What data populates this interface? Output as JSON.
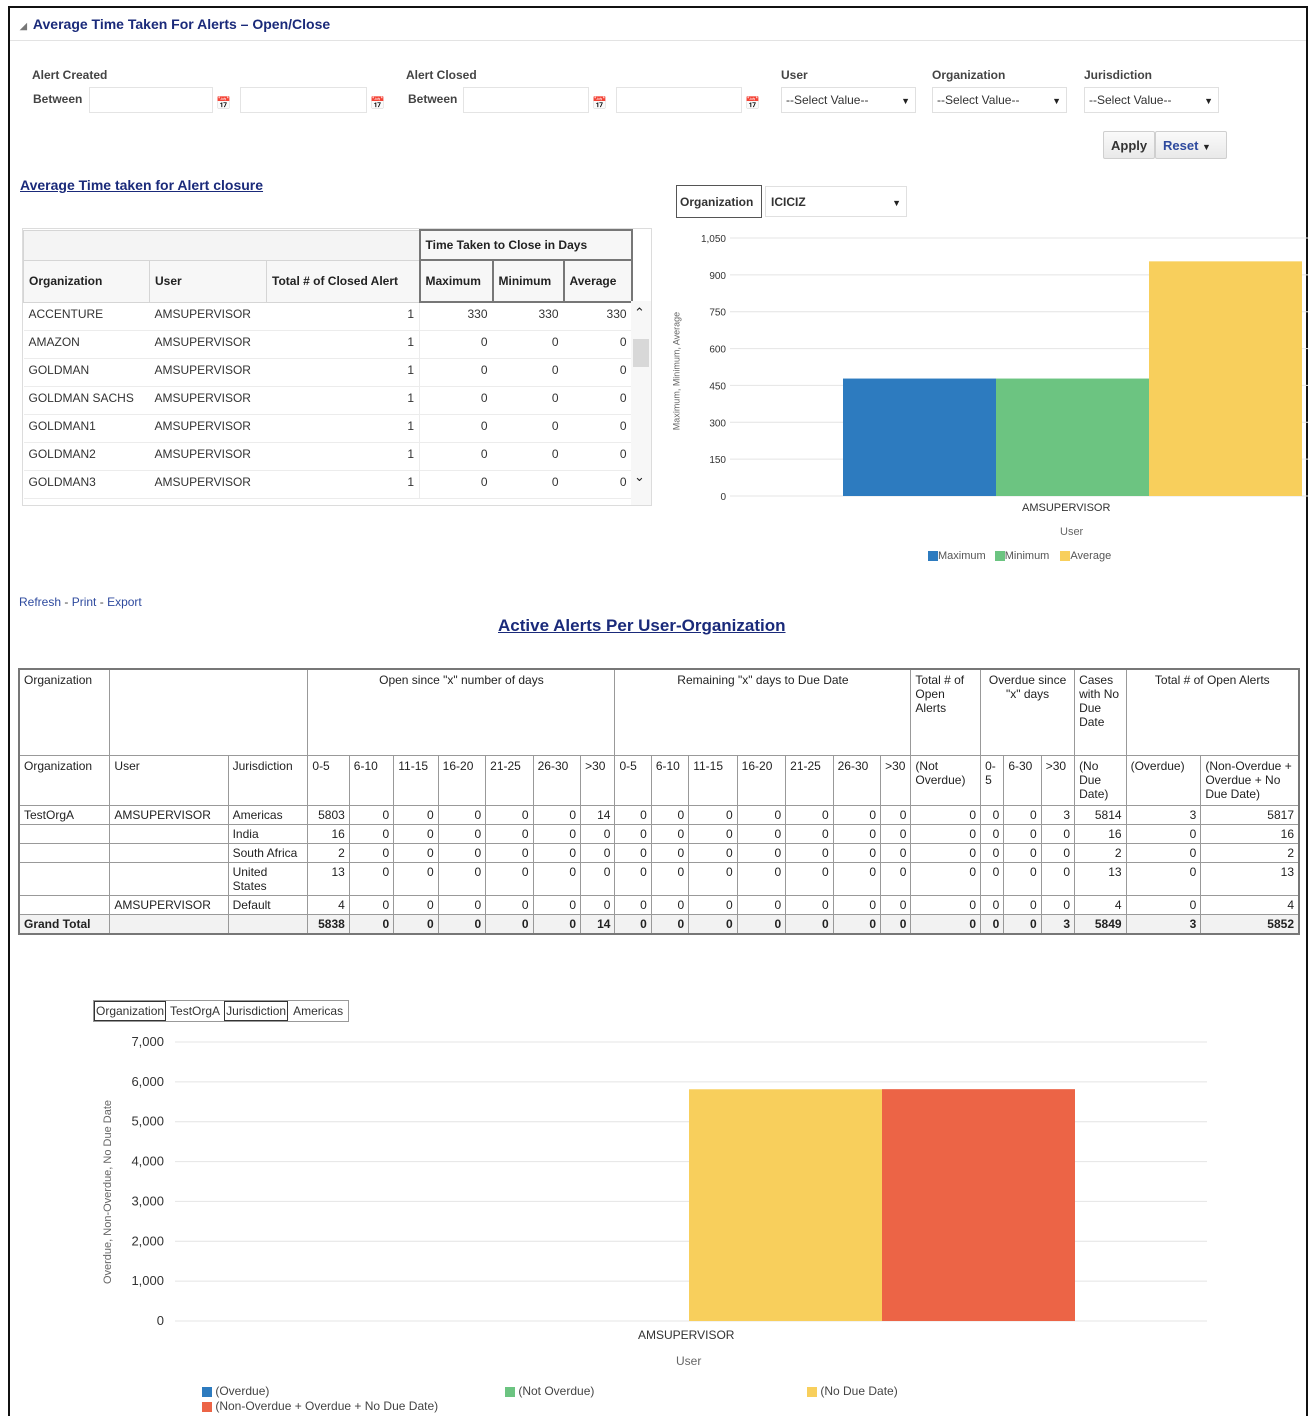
{
  "section_title": "Average Time Taken For Alerts – Open/Close",
  "filters": {
    "alert_created": "Alert Created",
    "alert_closed": "Alert Closed",
    "between": "Between",
    "user": "User",
    "organization": "Organization",
    "jurisdiction": "Jurisdiction",
    "select_placeholder": "--Select Value--",
    "apply": "Apply",
    "reset": "Reset"
  },
  "closure": {
    "title": "Average Time taken for Alert closure",
    "group_header": "Time Taken to Close in Days",
    "columns": [
      "Organization",
      "User",
      "Total # of Closed Alert",
      "Maximum",
      "Minimum",
      "Average"
    ],
    "rows": [
      [
        "ACCENTURE",
        "AMSUPERVISOR",
        "1",
        "330",
        "330",
        "330"
      ],
      [
        "AMAZON",
        "AMSUPERVISOR",
        "1",
        "0",
        "0",
        "0"
      ],
      [
        "GOLDMAN",
        "AMSUPERVISOR",
        "1",
        "0",
        "0",
        "0"
      ],
      [
        "GOLDMAN SACHS",
        "AMSUPERVISOR",
        "1",
        "0",
        "0",
        "0"
      ],
      [
        "GOLDMAN1",
        "AMSUPERVISOR",
        "1",
        "0",
        "0",
        "0"
      ],
      [
        "GOLDMAN2",
        "AMSUPERVISOR",
        "1",
        "0",
        "0",
        "0"
      ],
      [
        "GOLDMAN3",
        "AMSUPERVISOR",
        "1",
        "0",
        "0",
        "0"
      ]
    ]
  },
  "chart1_controls": {
    "label": "Organization",
    "value": "ICICIZ"
  },
  "actions": {
    "refresh": "Refresh",
    "print": "Print",
    "export": "Export",
    "sep": " - "
  },
  "active": {
    "title": "Active Alerts Per User-Organization",
    "top_headers": {
      "organization": "Organization",
      "open_since": "Open since \"x\" number of days",
      "remaining": "Remaining \"x\" days to Due Date",
      "total_open": "Total # of Open Alerts",
      "overdue_since": "Overdue since \"x\" days",
      "cases_no_due": "Cases with No Due Date",
      "total_open_alerts": "Total # of Open Alerts"
    },
    "sub_headers": [
      "Organization",
      "User",
      "Jurisdiction",
      "0-5",
      "6-10",
      "11-15",
      "16-20",
      "21-25",
      "26-30",
      ">30",
      "0-5",
      "6-10",
      "11-15",
      "16-20",
      "21-25",
      "26-30",
      ">30",
      "(Not Overdue)",
      "0-5",
      "6-30",
      ">30",
      "(No Due Date)",
      "(Overdue)",
      "(Non-Overdue + Overdue + No Due Date)"
    ],
    "rows": [
      [
        "TestOrgA",
        "AMSUPERVISOR",
        "Americas",
        "5803",
        "0",
        "0",
        "0",
        "0",
        "0",
        "14",
        "0",
        "0",
        "0",
        "0",
        "0",
        "0",
        "0",
        "0",
        "0",
        "0",
        "3",
        "5814",
        "3",
        "5817"
      ],
      [
        "",
        "",
        "India",
        "16",
        "0",
        "0",
        "0",
        "0",
        "0",
        "0",
        "0",
        "0",
        "0",
        "0",
        "0",
        "0",
        "0",
        "0",
        "0",
        "0",
        "0",
        "16",
        "0",
        "16"
      ],
      [
        "",
        "",
        "South Africa",
        "2",
        "0",
        "0",
        "0",
        "0",
        "0",
        "0",
        "0",
        "0",
        "0",
        "0",
        "0",
        "0",
        "0",
        "0",
        "0",
        "0",
        "0",
        "2",
        "0",
        "2"
      ],
      [
        "",
        "",
        "United States",
        "13",
        "0",
        "0",
        "0",
        "0",
        "0",
        "0",
        "0",
        "0",
        "0",
        "0",
        "0",
        "0",
        "0",
        "0",
        "0",
        "0",
        "0",
        "13",
        "0",
        "13"
      ],
      [
        "",
        "AMSUPERVISOR",
        "Default",
        "4",
        "0",
        "0",
        "0",
        "0",
        "0",
        "0",
        "0",
        "0",
        "0",
        "0",
        "0",
        "0",
        "0",
        "0",
        "0",
        "0",
        "0",
        "4",
        "0",
        "4"
      ]
    ],
    "grand_total": [
      "Grand Total",
      "",
      "",
      "5838",
      "0",
      "0",
      "0",
      "0",
      "0",
      "14",
      "0",
      "0",
      "0",
      "0",
      "0",
      "0",
      "0",
      "0",
      "0",
      "0",
      "3",
      "5849",
      "3",
      "5852"
    ]
  },
  "chart2_controls": {
    "org_label": "Organization",
    "org_value": "TestOrgA",
    "jur_label": "Jurisdiction",
    "jur_value": "Americas"
  },
  "colors": {
    "blue": "#2d7bbf",
    "green": "#6cc481",
    "yellow": "#f8cf5c",
    "orange": "#ec6446"
  },
  "chart_data": [
    {
      "type": "bar",
      "categories": [
        "AMSUPERVISOR"
      ],
      "series": [
        {
          "name": "Maximum",
          "values": [
            478
          ]
        },
        {
          "name": "Minimum",
          "values": [
            478
          ]
        },
        {
          "name": "Average",
          "values": [
            955
          ]
        }
      ],
      "xlabel": "User",
      "ylabel": "Maximum, Minimum, Average",
      "ylim": [
        0,
        1050
      ],
      "yticks": [
        "1,050",
        "900",
        "750",
        "600",
        "450",
        "300",
        "150",
        "0"
      ],
      "legend": "bottom"
    },
    {
      "type": "bar",
      "categories": [
        "AMSUPERVISOR"
      ],
      "series": [
        {
          "name": "(Overdue)",
          "values": [
            0
          ]
        },
        {
          "name": "(Not Overdue)",
          "values": [
            0
          ]
        },
        {
          "name": "(No Due Date)",
          "values": [
            5814
          ]
        },
        {
          "name": "(Non-Overdue + Overdue + No Due Date)",
          "values": [
            5817
          ]
        }
      ],
      "xlabel": "User",
      "ylabel": "Overdue, Non-Overdue, No Due Date",
      "ylim": [
        0,
        7000
      ],
      "yticks": [
        "7,000",
        "6,000",
        "5,000",
        "4,000",
        "3,000",
        "2,000",
        "1,000",
        "0"
      ],
      "legend": "bottom"
    }
  ]
}
